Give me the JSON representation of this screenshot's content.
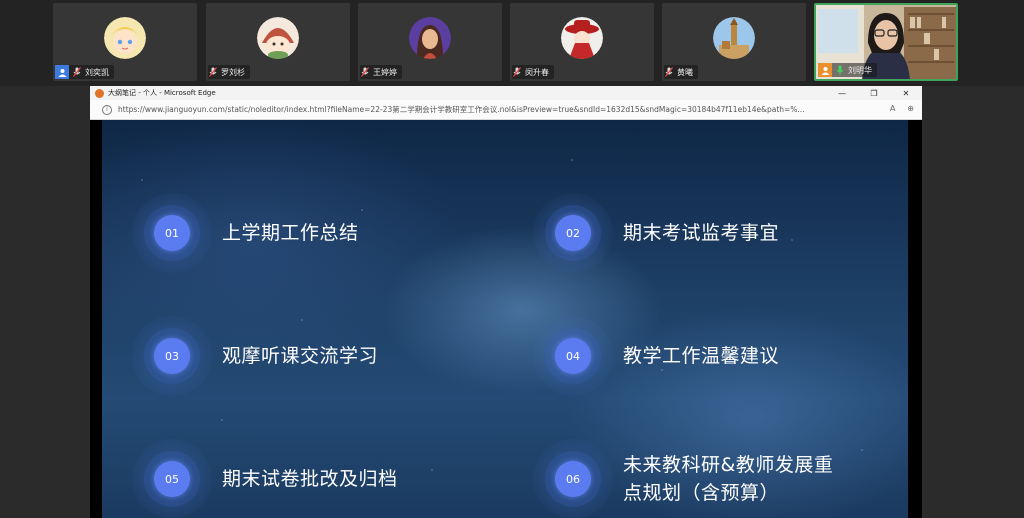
{
  "participants": [
    {
      "name": "刘奕凯",
      "role": "participant"
    },
    {
      "name": "罗刘杉",
      "role": "participant"
    },
    {
      "name": "王婷婷",
      "role": "participant"
    },
    {
      "name": "闵升春",
      "role": "participant"
    },
    {
      "name": "黄曦",
      "role": "participant"
    },
    {
      "name": "刘明华",
      "role": "host",
      "active": true
    }
  ],
  "browser": {
    "title": "大纲笔记 - 个人 - Microsoft Edge",
    "url": "https://www.jianguoyun.com/static/noleditor/index.html?fileName=22-23第二学期会计学教研室工作会议.nol&isPreview=true&sndId=1632d15&sndMagic=30184b47f11eb14e&path=%...",
    "controls": {
      "minimize": "—",
      "restore": "❐",
      "close": "✕"
    },
    "address_icons": {
      "read_aloud": "A",
      "zoom": "⊕"
    }
  },
  "slide": {
    "items": [
      {
        "num": "01",
        "label": "上学期工作总结"
      },
      {
        "num": "02",
        "label": "期末考试监考事宜"
      },
      {
        "num": "03",
        "label": "观摩听课交流学习"
      },
      {
        "num": "04",
        "label": "教学工作温馨建议"
      },
      {
        "num": "05",
        "label": "期末试卷批改及归档"
      },
      {
        "num": "06",
        "label": "未来教科研&教师发展重点规划（含预算）"
      }
    ]
  },
  "colors": {
    "badge": "#5b7cf0",
    "host_badge": "#e8912e",
    "user_badge": "#3d7be0",
    "active_border": "#3fa35a"
  }
}
